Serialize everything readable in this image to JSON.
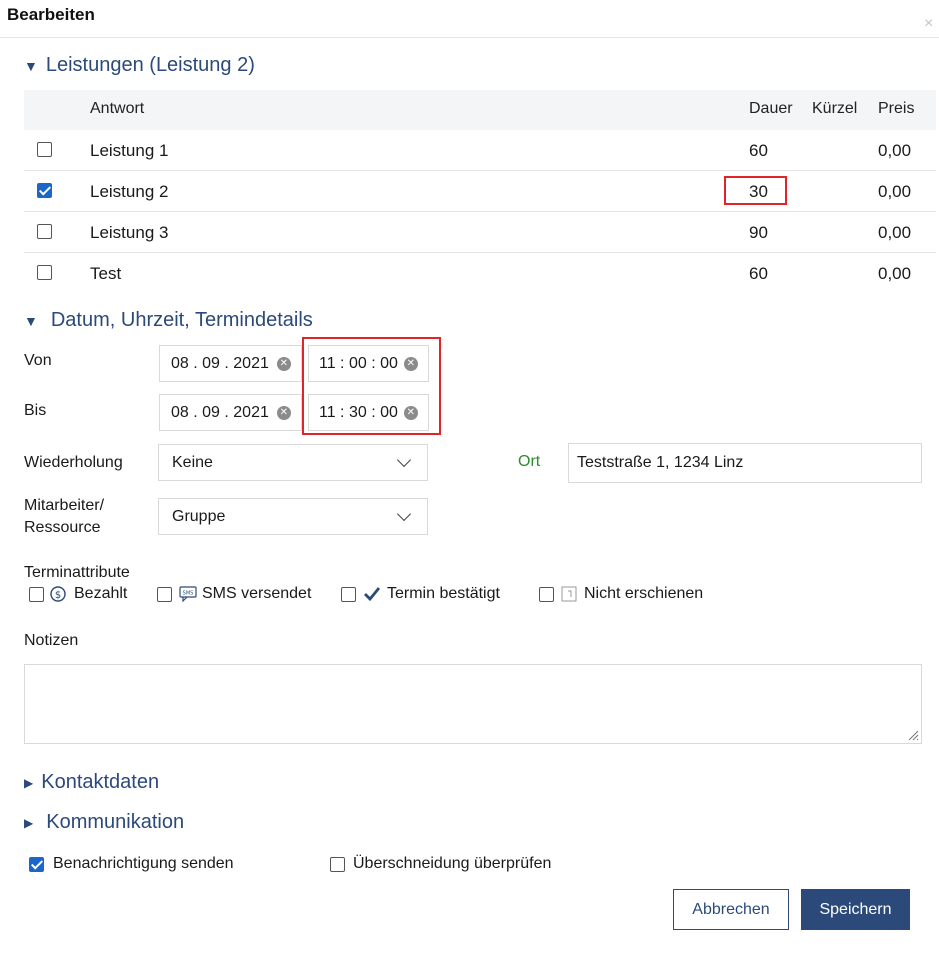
{
  "dialog": {
    "title": "Bearbeiten",
    "close_glyph": "×"
  },
  "services": {
    "header": "Leistungen (Leistung 2)",
    "columns": {
      "answer": "Antwort",
      "duration": "Dauer",
      "short": "Kürzel",
      "price": "Preis"
    },
    "rows": [
      {
        "checked": false,
        "name": "Leistung 1",
        "duration": "60",
        "short": "",
        "price": "0,00"
      },
      {
        "checked": true,
        "name": "Leistung 2",
        "duration": "30",
        "short": "",
        "price": "0,00"
      },
      {
        "checked": false,
        "name": "Leistung 3",
        "duration": "90",
        "short": "",
        "price": "0,00"
      },
      {
        "checked": false,
        "name": "Test",
        "duration": "60",
        "short": "",
        "price": "0,00"
      }
    ]
  },
  "datetime": {
    "header": "Datum, Uhrzeit, Termindetails",
    "from_label": "Von",
    "from_date": "08 . 09 . 2021",
    "from_time": "11 : 00 : 00",
    "to_label": "Bis",
    "to_date": "08 . 09 . 2021",
    "to_time": "11 : 30 : 00",
    "repeat_label": "Wiederholung",
    "repeat_value": "Keine",
    "location_label": "Ort",
    "location_value": "Teststraße 1, 1234 Linz",
    "staff_label_line1": "Mitarbeiter/",
    "staff_label_line2": "Ressource",
    "staff_value": "Gruppe"
  },
  "attributes": {
    "label": "Terminattribute",
    "items": [
      "Bezahlt",
      "SMS versendet",
      "Termin bestätigt",
      "Nicht erschienen"
    ]
  },
  "notes": {
    "label": "Notizen",
    "value": ""
  },
  "contact": {
    "header": "Kontaktdaten"
  },
  "communication": {
    "header": "Kommunikation"
  },
  "options": {
    "send_notification": "Benachrichtigung senden",
    "check_overlap": "Überschneidung überprüfen"
  },
  "buttons": {
    "cancel": "Abbrechen",
    "save": "Speichern"
  },
  "colors": {
    "accent": "#2b4a7a",
    "checkbox": "#1a67c9",
    "highlight": "#e0242a",
    "location_label": "#2e8b2e"
  }
}
